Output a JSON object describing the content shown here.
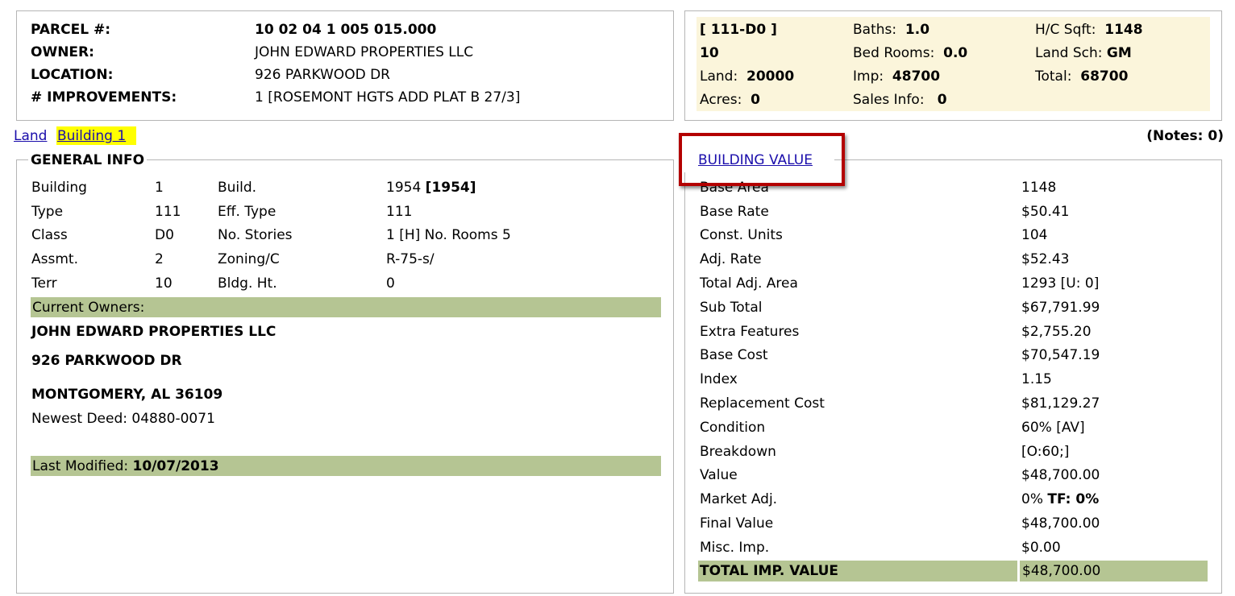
{
  "parcel_box": {
    "rows": [
      {
        "label": "PARCEL #:",
        "value": "10 02 04 1 005 015.000",
        "value_bold": true
      },
      {
        "label": "OWNER:",
        "value": "JOHN EDWARD PROPERTIES LLC",
        "value_bold": false
      },
      {
        "label": "LOCATION:",
        "value": "926 PARKWOOD DR",
        "value_bold": false
      },
      {
        "label": "# IMPROVEMENTS:",
        "value": "1 [ROSEMONT HGTS ADD PLAT B 27/3]",
        "value_bold": false
      }
    ]
  },
  "summary_box": {
    "code": "[ 111-D0 ]",
    "terr": "10",
    "land_label": "Land:",
    "land_value": "20000",
    "acres_label": "Acres:",
    "acres_value": "0",
    "baths_label": "Baths:",
    "baths_value": "1.0",
    "bedrooms_label": "Bed Rooms:",
    "bedrooms_value": "0.0",
    "imp_label": "Imp:",
    "imp_value": "48700",
    "sales_label": "Sales Info:",
    "sales_value": "0",
    "hc_sqft_label": "H/C Sqft:",
    "hc_sqft_value": "1148",
    "land_sch_label": "Land Sch:",
    "land_sch_value": "GM",
    "total_label": "Total:",
    "total_value": "68700"
  },
  "tabs": {
    "land": "Land",
    "building1": "Building 1"
  },
  "notes": "(Notes: 0)",
  "general_info": {
    "legend": "GENERAL INFO",
    "rows": [
      [
        "Building",
        "1",
        "Build.",
        "1954",
        "[1954]"
      ],
      [
        "Type",
        "111",
        "Eff. Type",
        "111",
        ""
      ],
      [
        "Class",
        "D0",
        "No. Stories",
        "1 [H] No. Rooms 5",
        ""
      ],
      [
        "Assmt.",
        "2",
        "Zoning/C",
        "R-75-s/",
        ""
      ],
      [
        "Terr",
        "10",
        "Bldg. Ht.",
        "0",
        ""
      ]
    ],
    "current_owners_label": "Current Owners:",
    "owner_name": "JOHN EDWARD PROPERTIES LLC",
    "owner_address1": "926 PARKWOOD DR",
    "owner_address2": "MONTGOMERY, AL 36109",
    "newest_deed_label": "Newest Deed:",
    "newest_deed_value": "04880-0071",
    "last_modified_label": "Last Modified:",
    "last_modified_value": "10/07/2013"
  },
  "building_value": {
    "legend": "BUILDING VALUE",
    "highlight_color": "#b30000",
    "rows": [
      {
        "label": "Base Area",
        "value": "1148"
      },
      {
        "label": "Base Rate",
        "value": "$50.41"
      },
      {
        "label": "Const. Units",
        "value": "104"
      },
      {
        "label": "Adj. Rate",
        "value": "$52.43"
      },
      {
        "label": "Total Adj. Area",
        "value": "1293 [U: 0]"
      },
      {
        "label": "Sub Total",
        "value": "$67,791.99"
      },
      {
        "label": "Extra Features",
        "value": "$2,755.20"
      },
      {
        "label": "Base Cost",
        "value": "$70,547.19"
      },
      {
        "label": "Index",
        "value": "1.15"
      },
      {
        "label": "Replacement Cost",
        "value": "$81,129.27"
      },
      {
        "label": "Condition",
        "value": "60% [AV]"
      },
      {
        "label": "Breakdown",
        "value": "[O:60;]"
      },
      {
        "label": "Value",
        "value": "$48,700.00"
      },
      {
        "label": "Market Adj.",
        "value": "0%",
        "extra": "TF: 0%"
      },
      {
        "label": "Final Value",
        "value": "$48,700.00"
      },
      {
        "label": "Misc. Imp.",
        "value": "$0.00"
      }
    ],
    "total_label": "TOTAL IMP. VALUE",
    "total_value": "$48,700.00"
  },
  "colors": {
    "summary_bg": "#fbf5db",
    "green_bar": "#b5c593",
    "tab_highlight": "#ffff00",
    "link": "#1a0dab"
  }
}
